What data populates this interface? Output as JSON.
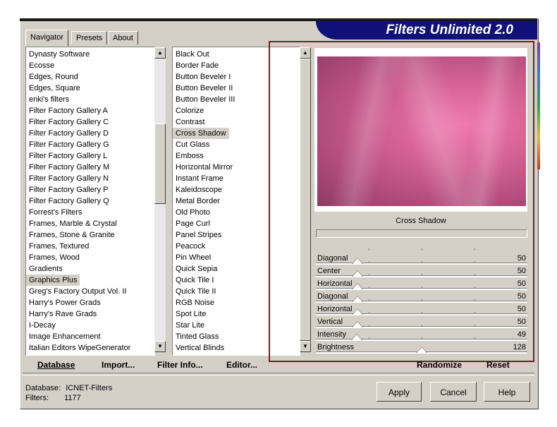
{
  "brand": {
    "title": "Filters Unlimited 2.0"
  },
  "tabs": [
    {
      "label": "Navigator",
      "active": true
    },
    {
      "label": "Presets",
      "active": false
    },
    {
      "label": "About",
      "active": false
    }
  ],
  "categories": {
    "items": [
      "Dynasty Software",
      "Ecosse",
      "Edges, Round",
      "Edges, Square",
      "enki's filters",
      "Filter Factory Gallery A",
      "Filter Factory Gallery C",
      "Filter Factory Gallery D",
      "Filter Factory Gallery G",
      "Filter Factory Gallery L",
      "Filter Factory Gallery M",
      "Filter Factory Gallery N",
      "Filter Factory Gallery P",
      "Filter Factory Gallery Q",
      "Forrest's Filters",
      "Frames, Marble & Crystal",
      "Frames, Stone & Granite",
      "Frames, Textured",
      "Frames, Wood",
      "Gradients",
      "Graphics Plus",
      "Greg's Factory Output Vol. II",
      "Harry's Power Grads",
      "Harry's Rave Grads",
      "I-Decay",
      "Image Enhancement",
      "Italian Editors WipeGenerator"
    ],
    "selected": "Graphics Plus"
  },
  "filters": {
    "items": [
      "Black Out",
      "Border Fade",
      "Button Beveler I",
      "Button Beveler II",
      "Button Beveler III",
      "Colorize",
      "Contrast",
      "Cross Shadow",
      "Cut Glass",
      "Emboss",
      "Horizontal Mirror",
      "Instant Frame",
      "Kaleidoscope",
      "Metal Border",
      "Old Photo",
      "Page Curl",
      "Panel Stripes",
      "Peacock",
      "Pin Wheel",
      "Quick Sepia",
      "Quick Tile I",
      "Quick Tile II",
      "RGB Noise",
      "Spot Lite",
      "Star Lite",
      "Tinted Glass",
      "Vertical Blinds"
    ],
    "selected": "Cross Shadow"
  },
  "preview": {
    "filter_name": "Cross Shadow"
  },
  "sliders": [
    {
      "label": "Diagonal",
      "value": "50",
      "level": 50
    },
    {
      "label": "Center",
      "value": "50",
      "level": 50
    },
    {
      "label": "Horizontal",
      "value": "50",
      "level": 50
    },
    {
      "label": "Diagonal",
      "value": "50",
      "level": 50
    },
    {
      "label": "Horizontal",
      "value": "50",
      "level": 50
    },
    {
      "label": "Vertical",
      "value": "50",
      "level": 50
    },
    {
      "label": "Intensity",
      "value": "49",
      "level": 49
    },
    {
      "label": "Brightness",
      "value": "128",
      "level": 128
    }
  ],
  "commands": {
    "database": "Database",
    "import": "Import...",
    "filter_info": "Filter Info...",
    "editor": "Editor...",
    "randomize": "Randomize",
    "reset": "Reset"
  },
  "status": {
    "database_label": "Database:",
    "database_value": "ICNET-Filters",
    "filters_label": "Filters:",
    "filters_value": "1177"
  },
  "buttons": {
    "apply": "Apply",
    "cancel": "Cancel",
    "help": "Help"
  },
  "colors": {
    "brand_bg": "#101078",
    "highlight": "#7a1a24",
    "dialog_bg": "#d4d0c8"
  }
}
